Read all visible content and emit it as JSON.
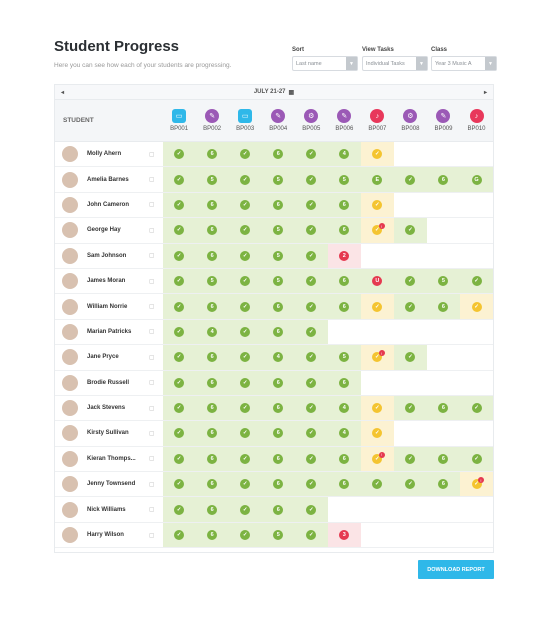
{
  "page": {
    "title": "Student Progress",
    "subtitle": "Here you can see how each of your students are progressing."
  },
  "filters": [
    {
      "label": "Sort",
      "value": "Last name"
    },
    {
      "label": "View Tasks",
      "value": "Individual Tasks"
    },
    {
      "label": "Class",
      "value": "Year 3 Music A"
    }
  ],
  "week": {
    "label": "JULY 21-27",
    "prev_icon": "chevron-left-icon",
    "next_icon": "chevron-right-icon",
    "calendar_icon": "calendar-icon"
  },
  "table": {
    "student_header": "STUDENT",
    "tasks": [
      {
        "code": "BP001",
        "icon": "screen-icon",
        "color": "#2fb8e9",
        "kind": "cyan"
      },
      {
        "code": "BP002",
        "icon": "pencil-icon",
        "color": "#9b59b6",
        "kind": "purple"
      },
      {
        "code": "BP003",
        "icon": "screen-icon",
        "color": "#2fb8e9",
        "kind": "cyan"
      },
      {
        "code": "BP004",
        "icon": "pencil-icon",
        "color": "#9b59b6",
        "kind": "purple"
      },
      {
        "code": "BP005",
        "icon": "gears-icon",
        "color": "#9b59b6",
        "kind": "purple"
      },
      {
        "code": "BP006",
        "icon": "pencil-icon",
        "color": "#9b59b6",
        "kind": "purple"
      },
      {
        "code": "BP007",
        "icon": "music-icon",
        "color": "#e8385b",
        "kind": "red"
      },
      {
        "code": "BP008",
        "icon": "gears-icon",
        "color": "#9b59b6",
        "kind": "purple"
      },
      {
        "code": "BP009",
        "icon": "pencil-icon",
        "color": "#9b59b6",
        "kind": "purple"
      },
      {
        "code": "BP010",
        "icon": "music-icon",
        "color": "#e8385b",
        "kind": "red"
      }
    ],
    "students": [
      {
        "name": "Molly Ahern",
        "cells": [
          "c",
          "6",
          "c",
          "6",
          "c",
          "4",
          "y",
          "",
          "",
          ""
        ]
      },
      {
        "name": "Amelia Barnes",
        "cells": [
          "c",
          "5",
          "c",
          "5",
          "c",
          "5",
          "E",
          "c",
          "6",
          "G"
        ]
      },
      {
        "name": "John Cameron",
        "cells": [
          "c",
          "6",
          "c",
          "6",
          "c",
          "6",
          "y",
          "",
          "",
          ""
        ]
      },
      {
        "name": "George Hay",
        "cells": [
          "c",
          "6",
          "c",
          "5",
          "c",
          "6",
          "y!",
          "c",
          "",
          ""
        ]
      },
      {
        "name": "Sam Johnson",
        "cells": [
          "c",
          "6",
          "c",
          "5",
          "c",
          "r2",
          "",
          "",
          "",
          ""
        ]
      },
      {
        "name": "James Moran",
        "cells": [
          "c",
          "5",
          "c",
          "5",
          "c",
          "6",
          "U",
          "c",
          "5",
          "c"
        ]
      },
      {
        "name": "William Norrie",
        "cells": [
          "c",
          "6",
          "c",
          "6",
          "c",
          "6",
          "y",
          "c",
          "6",
          "y"
        ]
      },
      {
        "name": "Marian Patricks",
        "cells": [
          "c",
          "4",
          "c",
          "6",
          "c",
          "",
          "",
          "",
          "",
          ""
        ]
      },
      {
        "name": "Jane Pryce",
        "cells": [
          "c",
          "6",
          "c",
          "4",
          "c",
          "5",
          "y!",
          "c",
          "",
          ""
        ]
      },
      {
        "name": "Brodie Russell",
        "cells": [
          "c",
          "6",
          "c",
          "6",
          "c",
          "6",
          "",
          "",
          "",
          ""
        ]
      },
      {
        "name": "Jack Stevens",
        "cells": [
          "c",
          "6",
          "c",
          "6",
          "c",
          "4",
          "y",
          "c",
          "6",
          "c"
        ]
      },
      {
        "name": "Kirsty Sullivan",
        "cells": [
          "c",
          "6",
          "c",
          "6",
          "c",
          "4",
          "y",
          "",
          "",
          ""
        ]
      },
      {
        "name": "Kieran Thomps...",
        "cells": [
          "c",
          "6",
          "c",
          "6",
          "c",
          "6",
          "y!",
          "c",
          "6",
          "c"
        ]
      },
      {
        "name": "Jenny Townsend",
        "cells": [
          "c",
          "6",
          "c",
          "6",
          "c",
          "6",
          "c",
          "c",
          "6",
          "y!"
        ]
      },
      {
        "name": "Nick Williams",
        "cells": [
          "c",
          "6",
          "c",
          "6",
          "c",
          "",
          "",
          "",
          "",
          ""
        ]
      },
      {
        "name": "Harry Wilson",
        "cells": [
          "c",
          "6",
          "c",
          "5",
          "c",
          "r3",
          "",
          "",
          "",
          ""
        ]
      }
    ]
  },
  "actions": {
    "download_label": "DOWNLOAD REPORT"
  },
  "colors": {
    "accent": "#2fb8e9",
    "complete": "#7cb342",
    "pending": "#f4c430",
    "alert": "#e53950"
  }
}
